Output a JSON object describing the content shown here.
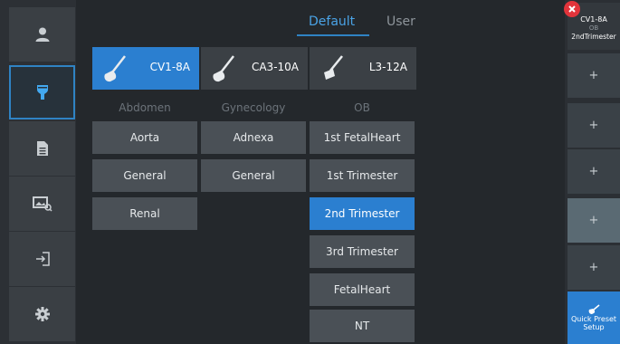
{
  "tabs": {
    "default_label": "Default",
    "user_label": "User",
    "active": "Default"
  },
  "sidebar": {
    "items": [
      {
        "name": "user-icon"
      },
      {
        "name": "probe-icon",
        "active": true
      },
      {
        "name": "document-icon"
      },
      {
        "name": "image-search-icon"
      },
      {
        "name": "exit-icon"
      },
      {
        "name": "gear-icon"
      }
    ]
  },
  "probes": [
    {
      "label": "CV1-8A",
      "active": true
    },
    {
      "label": "CA3-10A",
      "active": false
    },
    {
      "label": "L3-12A",
      "active": false
    }
  ],
  "categories": [
    {
      "label": "Abdomen",
      "presets": [
        "Aorta",
        "General",
        "Renal"
      ]
    },
    {
      "label": "Gynecology",
      "presets": [
        "Adnexa",
        "General"
      ]
    },
    {
      "label": "OB",
      "presets": [
        "1st FetalHeart",
        "1st Trimester",
        "2nd Trimester",
        "3rd Trimester",
        "FetalHeart",
        "NT"
      ],
      "active_preset": "2nd Trimester"
    }
  ],
  "right_panel": {
    "active_preset": {
      "probe": "CV1-8A",
      "category": "OB",
      "preset": "2ndTrimester"
    },
    "slot_label": "+",
    "quick_preset_label": "Quick Preset Setup"
  },
  "colors": {
    "accent": "#2b7fd0",
    "close": "#e2343b"
  }
}
